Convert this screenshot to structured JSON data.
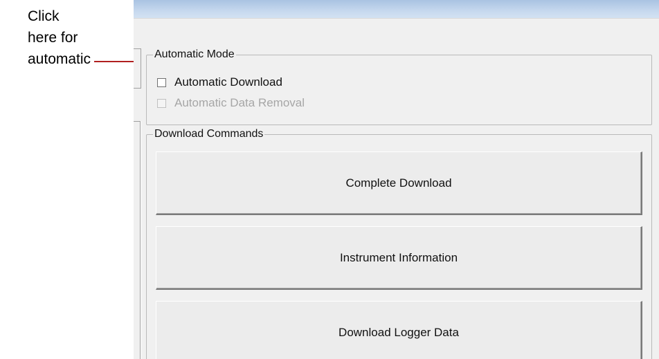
{
  "callout": {
    "lines": [
      "Click",
      "here for",
      "automatic"
    ]
  },
  "automatic_mode": {
    "legend": "Automatic Mode",
    "automatic_download": {
      "label": "Automatic Download",
      "checked": false,
      "enabled": true
    },
    "automatic_data_removal": {
      "label": "Automatic Data Removal",
      "checked": false,
      "enabled": false
    }
  },
  "download_commands": {
    "legend": "Download Commands",
    "buttons": [
      "Complete Download",
      "Instrument Information",
      "Download Logger Data"
    ]
  },
  "colors": {
    "callout_line": "#b02020",
    "window_bg": "#f0f0f0",
    "titlebar": "#c6d8ee"
  }
}
